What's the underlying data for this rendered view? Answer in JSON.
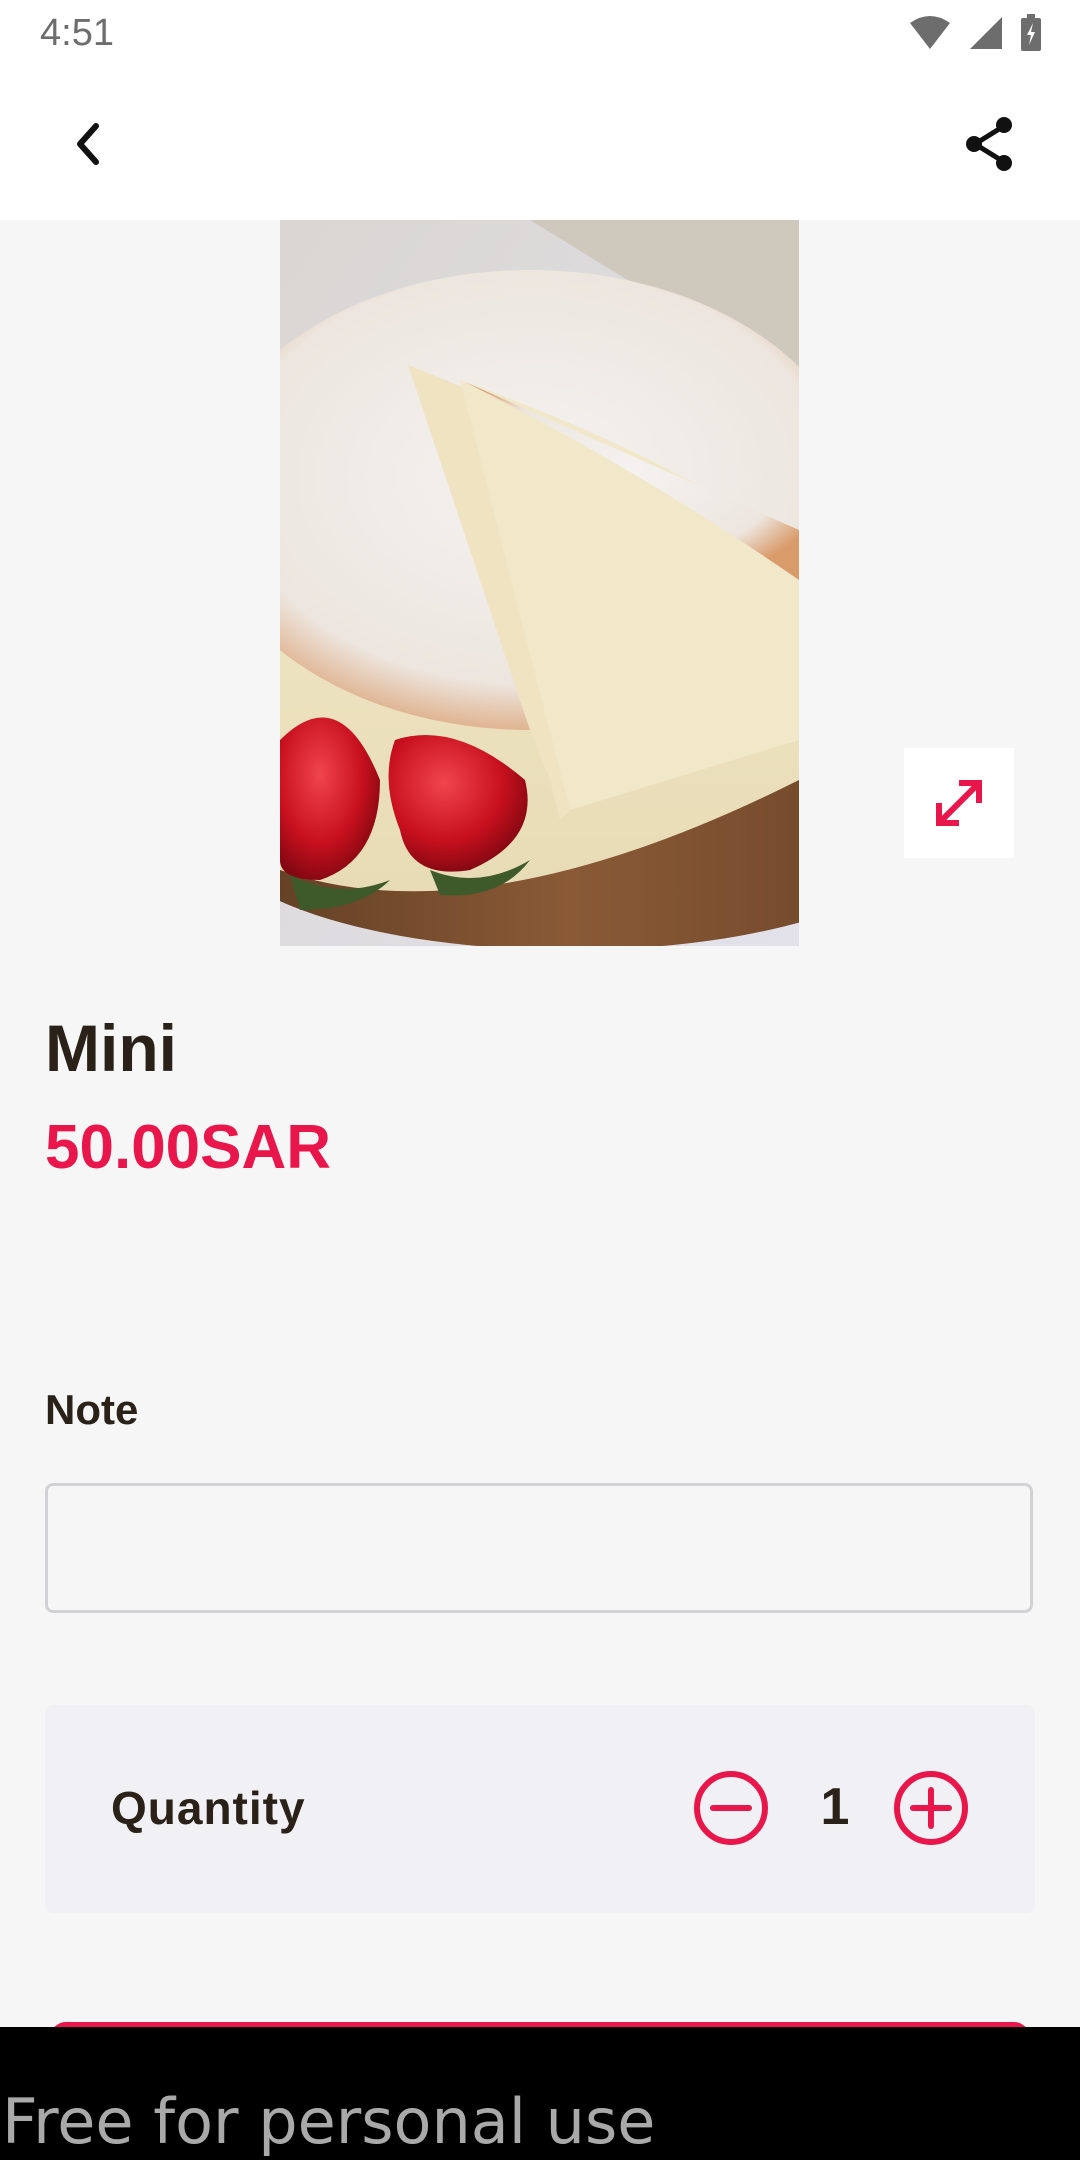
{
  "status_bar": {
    "time": "4:51"
  },
  "app_bar": {
    "back_icon": "chevron-left-icon",
    "share_icon": "share-icon"
  },
  "product": {
    "image_icon": "cheesecake-photo",
    "expand_icon": "expand-arrows-icon",
    "name": "Mini",
    "price": "50.00SAR"
  },
  "note": {
    "label": "Note",
    "value": "",
    "placeholder": ""
  },
  "quantity": {
    "label": "Quantity",
    "value": "1",
    "minus_icon": "minus-circle-icon",
    "plus_icon": "plus-circle-icon"
  },
  "watermark": {
    "text": "Free for personal use"
  },
  "colors": {
    "accent": "#e8164a",
    "text_dark": "#2a2219",
    "background": "#f6f6f7"
  }
}
